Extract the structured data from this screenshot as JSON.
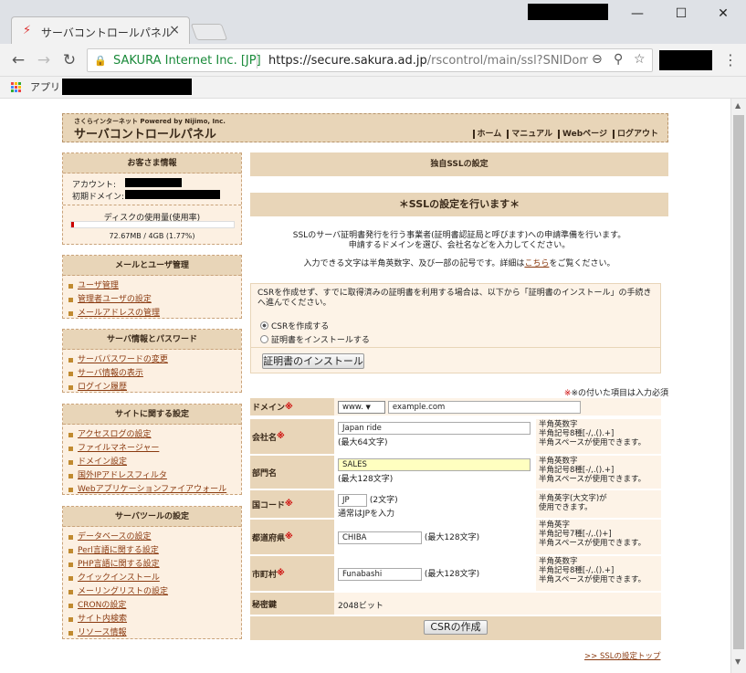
{
  "browser": {
    "tab_title": "サーバコントロールパネル",
    "org": "SAKURA Internet Inc. [JP]",
    "url_host": "https://secure.sakura.ad.jp",
    "url_path": "/rscontrol/main/ssl?SNIDomai",
    "apps_label": "アプリ",
    "win_min": "—",
    "win_max": "☐",
    "win_close": "✕"
  },
  "header": {
    "brand_small": "さくらインターネット Powered by Nijimo, Inc.",
    "brand_title": "サーバコントロールパネル",
    "links": [
      "ホーム",
      "マニュアル",
      "Webページ",
      "ログアウト"
    ]
  },
  "customer": {
    "title": "お客さま情報",
    "account_label": "アカウント:",
    "domain_label": "初期ドメイン:",
    "disk_title": "ディスクの使用量(使用率)",
    "disk_usage": "72.67MB / 4GB (1.77%)",
    "disk_ratio": 0.0177
  },
  "menus": [
    {
      "title": "メールとユーザ管理",
      "items": [
        "ユーザ管理",
        "管理者ユーザの設定",
        "メールアドレスの管理"
      ]
    },
    {
      "title": "サーバ情報とパスワード",
      "items": [
        "サーバパスワードの変更",
        "サーバ情報の表示",
        "ログイン履歴"
      ]
    },
    {
      "title": "サイトに関する設定",
      "items": [
        "アクセスログの設定",
        "ファイルマネージャー",
        "ドメイン設定",
        "国外IPアドレスフィルタ",
        "Webアプリケーションファイアウォール"
      ]
    },
    {
      "title": "サーバツールの設定",
      "items": [
        "データベースの設定",
        "Perl言語に関する設定",
        "PHP言語に関する設定",
        "クイックインストール",
        "メーリングリストの設定",
        "CRONの設定",
        "サイト内検索",
        "リソース情報"
      ]
    }
  ],
  "main": {
    "page_title": "独自SSLの設定",
    "section_title": "＊SSLの設定を行います＊",
    "intro1": "SSLのサーバ証明書発行を行う事業者(証明書認証局と呼びます)への申請準備を行います。",
    "intro2": "申請するドメインを選び、会社名などを入力してください。",
    "intro3a": "入力できる文字は半角英数字、及び一部の記号です。詳細は",
    "intro3link": "こちら",
    "intro3b": "をご覧ください。",
    "csr_note": "CSRを作成せず、すでに取得済みの証明書を利用する場合は、以下から「証明書のインストール」の手続きへ進んでください。",
    "radio_create": "CSRを作成する",
    "radio_install": "証明書をインストールする",
    "install_button": "証明書のインストール",
    "required_note": "※の付いた項目は入力必須",
    "form": {
      "domain": {
        "label": "ドメイン",
        "req": "※",
        "prefix": "www.",
        "value": "example.com"
      },
      "company": {
        "label": "会社名",
        "req": "※",
        "value": "Japan ride",
        "hint": "(最大64文字)",
        "note": "半角英数字\n半角記号8種[-/,.().+]\n半角スペースが使用できます。"
      },
      "dept": {
        "label": "部門名",
        "req": "",
        "value": "SALES",
        "hint": "(最大128文字)",
        "note": "半角英数字\n半角記号8種[-/,.().+]\n半角スペースが使用できます。"
      },
      "country": {
        "label": "国コード",
        "req": "※",
        "value": "JP",
        "hint": "(2文字)",
        "hint2": "通常はJPを入力",
        "note": "半角英字(大文字)が\n使用できます。"
      },
      "pref": {
        "label": "都道府県",
        "req": "※",
        "value": "CHIBA",
        "hint": "(最大128文字)",
        "note": "半角英字\n半角記号7種[-/,.()+]\n半角スペースが使用できます。"
      },
      "city": {
        "label": "市町村",
        "req": "※",
        "value": "Funabashi",
        "hint": "(最大128文字)",
        "note": "半角英数字\n半角記号8種[-/,.().+]\n半角スペースが使用できます。"
      },
      "keylen": {
        "label": "秘密鍵",
        "value": "2048ビット"
      }
    },
    "csr_button": "CSRの作成",
    "top_link": ">> SSLの設定トップ"
  }
}
